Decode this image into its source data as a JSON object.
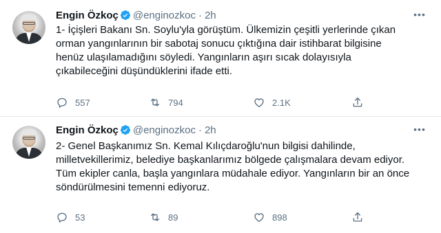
{
  "tweets": [
    {
      "name": "Engin Özkoç",
      "handle": "@enginozkoc",
      "separator": "·",
      "time": "2h",
      "text": "1- İçişleri Bakanı Sn. Soylu'yla görüştüm. Ülkemizin çeşitli yerlerinde çıkan\norman yangınlarının bir sabotaj sonucu çıktığına dair istihbarat bilgisine\nhenüz ulaşılamadığını söyledi. Yangınların aşırı sıcak dolayısıyla\nçıkabileceğini düşündüklerini ifade etti.",
      "replies": "557",
      "retweets": "794",
      "likes": "2.1K"
    },
    {
      "name": "Engin Özkoç",
      "handle": "@enginozkoc",
      "separator": "·",
      "time": "2h",
      "text": "2- Genel Başkanımız Sn. Kemal Kılıçdaroğlu'nun bilgisi dahilinde,\nmilletvekillerimiz, belediye başkanlarımız bölgede çalışmalara devam ediyor.\nTüm ekipler canla, başla yangınlara müdahale ediyor. Yangınların bir an önce\nsöndürülmesini temenni ediyoruz.",
      "replies": "53",
      "retweets": "89",
      "likes": "898"
    }
  ],
  "icons": {
    "verified": "verified-badge-icon",
    "more": "more-options-icon",
    "reply": "reply-icon",
    "retweet": "retweet-icon",
    "like": "like-icon",
    "share": "share-icon"
  },
  "colors": {
    "verified": "#1da1f2",
    "muted": "#5b7083",
    "text": "#0f1419",
    "divider": "#e6ecf0"
  }
}
